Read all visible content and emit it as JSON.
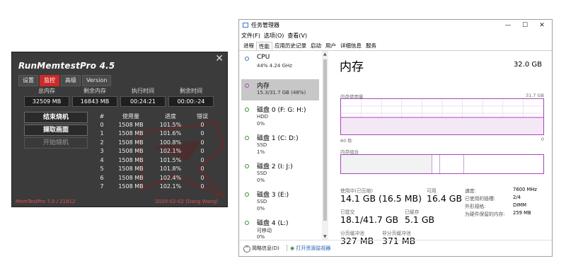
{
  "runmemtest": {
    "title": "RunMemtestPro 4.5",
    "close": "✕",
    "tabs": [
      "设置",
      "监控",
      "高级",
      "Version"
    ],
    "active_tab_index": 1,
    "stats_headers": [
      "总内存",
      "剩余内存",
      "执行时间",
      "剩余时间"
    ],
    "stats_values": [
      "32509 MB",
      "16843 MB",
      "00:24:21",
      "00:00:-24"
    ],
    "buttons": {
      "stop": "结束烧机",
      "capture": "撷取画面",
      "start": "开始烧机"
    },
    "table": {
      "headers": [
        "#",
        "使用量",
        "进度",
        "错误"
      ],
      "rows": [
        [
          "0",
          "1508 MB",
          "101.5%",
          "0"
        ],
        [
          "1",
          "1508 MB",
          "101.6%",
          "0"
        ],
        [
          "2",
          "1508 MB",
          "100.8%",
          "0"
        ],
        [
          "3",
          "1508 MB",
          "102.1%",
          "0"
        ],
        [
          "4",
          "1508 MB",
          "101.5%",
          "0"
        ],
        [
          "5",
          "1508 MB",
          "101.8%",
          "0"
        ],
        [
          "6",
          "1508 MB",
          "102.4%",
          "0"
        ],
        [
          "7",
          "1508 MB",
          "102.1%",
          "0"
        ]
      ]
    },
    "footer_left": "MemTestPro 7.0 / 21812",
    "footer_right": "2020-02-02 (Dang Wang)",
    "colors": {
      "accent": "#cc2a2a",
      "background": "#3b3b3b"
    }
  },
  "taskmgr": {
    "window_title": "任务管理器",
    "window_buttons": [
      "—",
      "☐",
      "✕"
    ],
    "menu": [
      "文件(F)",
      "选项(O)",
      "查看(V)"
    ],
    "tabs": [
      "进程",
      "性能",
      "应用历史记录",
      "启动",
      "用户",
      "详细信息",
      "服务"
    ],
    "active_tab_index": 1,
    "sidebar": [
      {
        "name": "CPU",
        "sub1": "44%  4.24 GHz",
        "sub2": ""
      },
      {
        "name": "内存",
        "sub1": "15.3/31.7 GB (48%)",
        "sub2": ""
      },
      {
        "name": "磁盘 0 (F: G: H:)",
        "sub1": "HDD",
        "sub2": "0%"
      },
      {
        "name": "磁盘 1 (C: D:)",
        "sub1": "SSD",
        "sub2": "1%"
      },
      {
        "name": "磁盘 2 (I: J:)",
        "sub1": "SSD",
        "sub2": "0%"
      },
      {
        "name": "磁盘 3 (E:)",
        "sub1": "SSD",
        "sub2": "0%"
      },
      {
        "name": "磁盘 4 (L:)",
        "sub1": "可移动",
        "sub2": "0%"
      }
    ],
    "active_sidebar_index": 1,
    "main": {
      "title": "内存",
      "total": "32.0 GB",
      "usage_label": "内存使用量",
      "usage_max": "31.7 GB",
      "axis_left": "60 秒",
      "axis_right": "0",
      "composition_label": "内存组合",
      "used_fraction": 0.48,
      "stats": [
        {
          "label": "使用中(已压缩)",
          "value": "14.1 GB (16.5 MB)"
        },
        {
          "label": "可用",
          "value": "16.4 GB"
        },
        {
          "label": "已提交",
          "value": "18.1/41.7 GB"
        },
        {
          "label": "已缓存",
          "value": "5.1 GB"
        },
        {
          "label": "分页缓冲池",
          "value": "327 MB"
        },
        {
          "label": "非分页缓冲池",
          "value": "371 MB"
        }
      ],
      "right_stats": [
        {
          "label": "速度:",
          "value": "7600 MHz"
        },
        {
          "label": "已使用的插槽:",
          "value": "2/4"
        },
        {
          "label": "外形规格:",
          "value": "DIMM"
        },
        {
          "label": "为硬件保留的内存:",
          "value": "259 MB"
        }
      ]
    },
    "bottom": {
      "fewer": "简略信息(D)",
      "monitor": "打开资源监视器"
    },
    "colors": {
      "memory": "#a548b8",
      "active_item": "#c7c7c7",
      "link": "#1a5fb4"
    }
  }
}
